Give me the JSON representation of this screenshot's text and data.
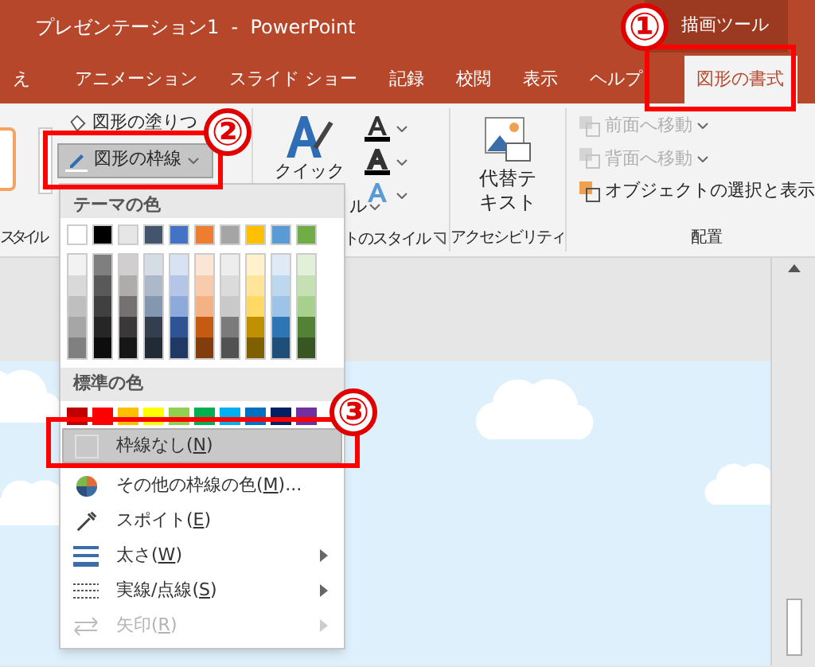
{
  "window": {
    "title": "プレゼンテーション1  -  PowerPoint",
    "context_tab_group": "描画ツール"
  },
  "tabs": [
    {
      "label": "え",
      "selected": false
    },
    {
      "label": "アニメーション",
      "selected": false
    },
    {
      "label": "スライド ショー",
      "selected": false
    },
    {
      "label": "記録",
      "selected": false
    },
    {
      "label": "校閲",
      "selected": false
    },
    {
      "label": "表示",
      "selected": false
    },
    {
      "label": "ヘルプ",
      "selected": false
    },
    {
      "label": "図形の書式",
      "selected": true
    }
  ],
  "ribbon": {
    "shape_styles": {
      "label": "スタイル",
      "fill_button": "図形の塗りつ",
      "outline_button": "図形の枠線"
    },
    "wordart_styles": {
      "quick_style_line_1": "クイック",
      "quick_style_line_2": "ル",
      "label": "トのスタイル"
    },
    "accessibility": {
      "alt_text_line_1": "代替テ",
      "alt_text_line_2": "キスト",
      "label": "アクセシビリティ"
    },
    "arrange": {
      "items": [
        {
          "label": "前面へ移動",
          "disabled": true
        },
        {
          "label": "背面へ移動",
          "disabled": true
        },
        {
          "label": "オブジェクトの選択と表示",
          "disabled": false
        }
      ],
      "label": "配置"
    }
  },
  "outline_menu": {
    "theme_header": "テーマの色",
    "theme_colors": [
      {
        "color": "#ffffff",
        "shades": [
          {
            "color": "#f2f2f2"
          },
          {
            "color": "#d9d9d9"
          },
          {
            "color": "#bfbfbf"
          },
          {
            "color": "#a6a6a6"
          },
          {
            "color": "#808080"
          }
        ]
      },
      {
        "color": "#000000",
        "shades": [
          {
            "color": "#7f7f7f"
          },
          {
            "color": "#595959"
          },
          {
            "color": "#404040"
          },
          {
            "color": "#262626"
          },
          {
            "color": "#0d0d0d"
          }
        ]
      },
      {
        "color": "#e7e6e6",
        "shades": [
          {
            "color": "#d0cece"
          },
          {
            "color": "#aeabab"
          },
          {
            "color": "#757171"
          },
          {
            "color": "#3a3838"
          },
          {
            "color": "#171616"
          }
        ]
      },
      {
        "color": "#44546a",
        "shades": [
          {
            "color": "#d6dce4"
          },
          {
            "color": "#adb9ca"
          },
          {
            "color": "#8497b0"
          },
          {
            "color": "#333f4f"
          },
          {
            "color": "#222a35"
          }
        ]
      },
      {
        "color": "#4472c4",
        "shades": [
          {
            "color": "#d9e2f3"
          },
          {
            "color": "#b4c6e7"
          },
          {
            "color": "#8eaadb"
          },
          {
            "color": "#2f5496"
          },
          {
            "color": "#1f3864"
          }
        ]
      },
      {
        "color": "#ed7d31",
        "shades": [
          {
            "color": "#fbe5d5"
          },
          {
            "color": "#f7cbac"
          },
          {
            "color": "#f4b183"
          },
          {
            "color": "#c55a11"
          },
          {
            "color": "#833c0b"
          }
        ]
      },
      {
        "color": "#a5a5a5",
        "shades": [
          {
            "color": "#ededed"
          },
          {
            "color": "#dbdbdb"
          },
          {
            "color": "#c9c9c9"
          },
          {
            "color": "#7b7b7b"
          },
          {
            "color": "#525252"
          }
        ]
      },
      {
        "color": "#ffc000",
        "shades": [
          {
            "color": "#fff2cc"
          },
          {
            "color": "#fee599"
          },
          {
            "color": "#ffd965"
          },
          {
            "color": "#bf9000"
          },
          {
            "color": "#7f6000"
          }
        ]
      },
      {
        "color": "#5b9bd5",
        "shades": [
          {
            "color": "#deebf6"
          },
          {
            "color": "#bdd7ee"
          },
          {
            "color": "#9dc3e6"
          },
          {
            "color": "#2e75b5"
          },
          {
            "color": "#1f4e79"
          }
        ]
      },
      {
        "color": "#70ad47",
        "shades": [
          {
            "color": "#e2efd9"
          },
          {
            "color": "#c5e0b3"
          },
          {
            "color": "#a8d08d"
          },
          {
            "color": "#538135"
          },
          {
            "color": "#375623"
          }
        ]
      }
    ],
    "standard_header": "標準の色",
    "standard_colors": [
      {
        "color": "#c00000"
      },
      {
        "color": "#ff0000"
      },
      {
        "color": "#ffc000"
      },
      {
        "color": "#ffff00"
      },
      {
        "color": "#92d050"
      },
      {
        "color": "#00b050"
      },
      {
        "color": "#00b0f0"
      },
      {
        "color": "#0070c0"
      },
      {
        "color": "#002060"
      },
      {
        "color": "#7030a0"
      }
    ],
    "items": [
      {
        "kind": "none",
        "before": "枠線なし(",
        "key": "N",
        "after": ")",
        "selected": true,
        "disabled": false,
        "submenu": false
      },
      {
        "kind": "more",
        "before": "その他の枠線の色(",
        "key": "M",
        "after": ")...",
        "selected": false,
        "disabled": false,
        "submenu": false
      },
      {
        "kind": "eyedropper",
        "before": "スポイト(",
        "key": "E",
        "after": ")",
        "selected": false,
        "disabled": false,
        "submenu": false
      },
      {
        "kind": "weight",
        "before": "太さ(",
        "key": "W",
        "after": ")",
        "selected": false,
        "disabled": false,
        "submenu": true
      },
      {
        "kind": "dash",
        "before": "実線/点線(",
        "key": "S",
        "after": ")",
        "selected": false,
        "disabled": false,
        "submenu": true
      },
      {
        "kind": "arrows",
        "before": "矢印(",
        "key": "R",
        "after": ")",
        "selected": false,
        "disabled": true,
        "submenu": true
      }
    ]
  },
  "annotations": [
    {
      "number": "①"
    },
    {
      "number": "②"
    },
    {
      "number": "③"
    }
  ]
}
